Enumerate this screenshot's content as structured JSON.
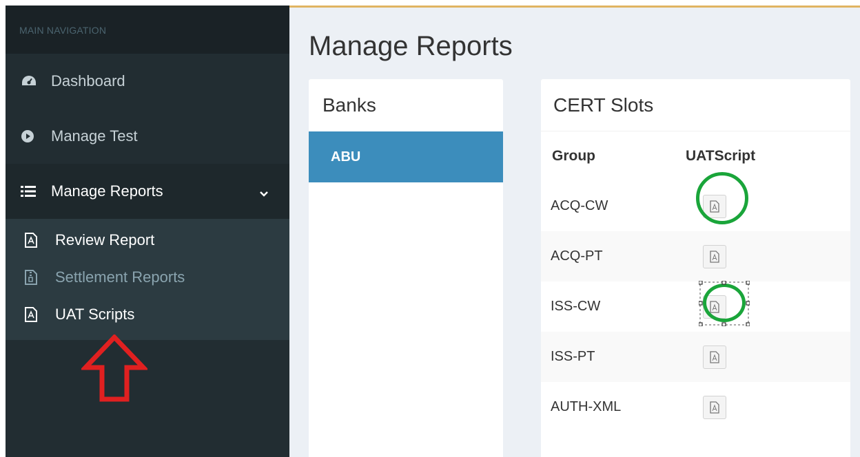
{
  "sidebar": {
    "header": "MAIN NAVIGATION",
    "items": [
      {
        "label": "Dashboard",
        "icon": "dashboard-icon"
      },
      {
        "label": "Manage Test",
        "icon": "play-circle-icon"
      },
      {
        "label": "Manage Reports",
        "icon": "list-icon"
      }
    ],
    "submenu": [
      {
        "label": "Review Report",
        "icon": "file-pdf-icon"
      },
      {
        "label": "Settlement Reports",
        "icon": "file-archive-icon"
      },
      {
        "label": "UAT Scripts",
        "icon": "file-pdf-icon"
      }
    ]
  },
  "page": {
    "title": "Manage Reports"
  },
  "banks": {
    "title": "Banks",
    "items": [
      "ABU"
    ]
  },
  "slots": {
    "title": "CERT Slots",
    "columns": [
      "Group",
      "UATScript"
    ],
    "rows": [
      "ACQ-CW",
      "ACQ-PT",
      "ISS-CW",
      "ISS-PT",
      "AUTH-XML"
    ]
  },
  "colors": {
    "sidebar_bg": "#222d32",
    "accent_blue": "#3c8dbc",
    "annotation_green": "#1aa53a",
    "annotation_red": "#e02020"
  }
}
